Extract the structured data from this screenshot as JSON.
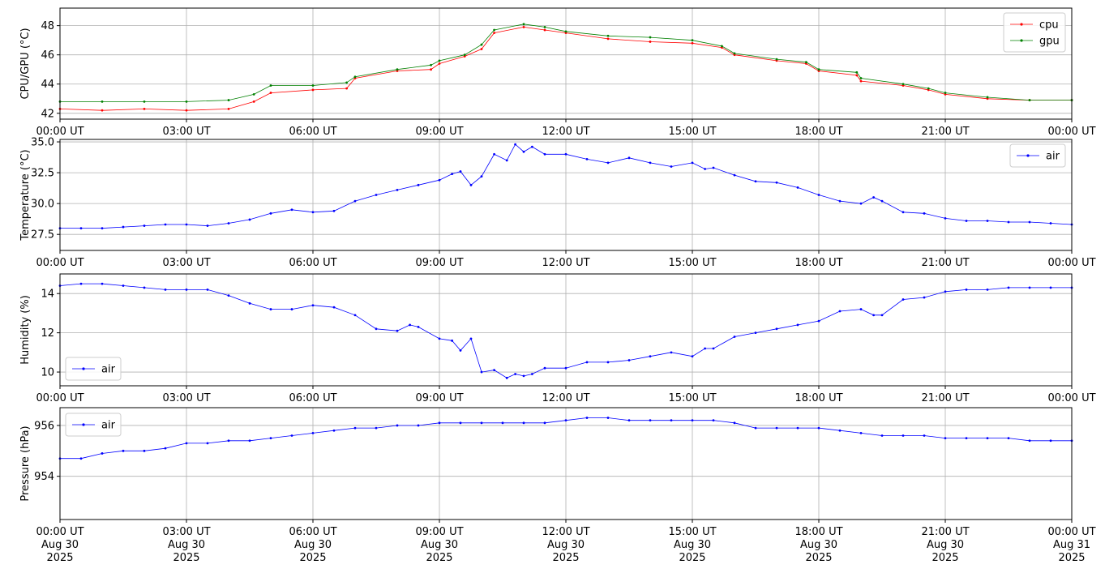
{
  "chart_data": [
    {
      "type": "line",
      "ylabel": "CPU/GPU (°C)",
      "ylim": [
        41.6,
        49.2
      ],
      "yticks": [
        42,
        44,
        46,
        48
      ],
      "ytick_labels": [
        "42",
        "44",
        "46",
        "48"
      ],
      "xticks": [
        0,
        3,
        6,
        9,
        12,
        15,
        18,
        21,
        24
      ],
      "xtick_labels": [
        "00:00 UT",
        "03:00 UT",
        "06:00 UT",
        "09:00 UT",
        "12:00 UT",
        "15:00 UT",
        "18:00 UT",
        "21:00 UT",
        "00:00 UT"
      ],
      "grid": true,
      "legend": "top-right",
      "series": [
        {
          "name": "cpu",
          "color": "#ff0000",
          "x": [
            0,
            1,
            2,
            3,
            4,
            4.6,
            5,
            6,
            6.8,
            7,
            8,
            8.8,
            9,
            9.6,
            10,
            10.3,
            11,
            11.5,
            12,
            13,
            14,
            15,
            15.7,
            16,
            17,
            17.7,
            18,
            18.9,
            19,
            20,
            20.6,
            21,
            22,
            23,
            24
          ],
          "y": [
            42.3,
            42.2,
            42.3,
            42.2,
            42.3,
            42.8,
            43.4,
            43.6,
            43.7,
            44.4,
            44.9,
            45.0,
            45.4,
            45.9,
            46.4,
            47.5,
            47.9,
            47.7,
            47.5,
            47.1,
            46.9,
            46.8,
            46.5,
            46.0,
            45.6,
            45.4,
            44.9,
            44.6,
            44.2,
            43.9,
            43.6,
            43.3,
            43.0,
            42.9,
            42.9
          ]
        },
        {
          "name": "gpu",
          "color": "#008000",
          "x": [
            0,
            1,
            2,
            3,
            4,
            4.6,
            5,
            6,
            6.8,
            7,
            8,
            8.8,
            9,
            9.6,
            10,
            10.3,
            11,
            11.5,
            12,
            13,
            14,
            15,
            15.7,
            16,
            17,
            17.7,
            18,
            18.9,
            19,
            20,
            20.6,
            21,
            22,
            23,
            24
          ],
          "y": [
            42.8,
            42.8,
            42.8,
            42.8,
            42.9,
            43.3,
            43.9,
            43.9,
            44.1,
            44.5,
            45.0,
            45.3,
            45.6,
            46.0,
            46.7,
            47.7,
            48.1,
            47.9,
            47.6,
            47.3,
            47.2,
            47.0,
            46.6,
            46.1,
            45.7,
            45.5,
            45.0,
            44.8,
            44.4,
            44.0,
            43.7,
            43.4,
            43.1,
            42.9,
            42.9
          ]
        }
      ]
    },
    {
      "type": "line",
      "ylabel": "Temperature (°C)",
      "ylim": [
        26.2,
        35.2
      ],
      "yticks": [
        27.5,
        30.0,
        32.5,
        35.0
      ],
      "ytick_labels": [
        "27.5",
        "30.0",
        "32.5",
        "35.0"
      ],
      "xticks": [
        0,
        3,
        6,
        9,
        12,
        15,
        18,
        21,
        24
      ],
      "xtick_labels": [
        "00:00 UT",
        "03:00 UT",
        "06:00 UT",
        "09:00 UT",
        "12:00 UT",
        "15:00 UT",
        "18:00 UT",
        "21:00 UT",
        "00:00 UT"
      ],
      "grid": true,
      "legend": "top-right",
      "series": [
        {
          "name": "air",
          "color": "#0000ff",
          "x": [
            0,
            0.5,
            1,
            1.5,
            2,
            2.5,
            3,
            3.5,
            4,
            4.5,
            5,
            5.5,
            6,
            6.5,
            7,
            7.5,
            8,
            8.5,
            9,
            9.3,
            9.5,
            9.75,
            10,
            10.3,
            10.6,
            10.8,
            11,
            11.2,
            11.5,
            12,
            12.5,
            13,
            13.5,
            14,
            14.5,
            15,
            15.3,
            15.5,
            16,
            16.5,
            17,
            17.5,
            18,
            18.5,
            19,
            19.3,
            19.5,
            20,
            20.5,
            21,
            21.5,
            22,
            22.5,
            23,
            23.5,
            24
          ],
          "y": [
            28.0,
            28.0,
            28.0,
            28.1,
            28.2,
            28.3,
            28.3,
            28.2,
            28.4,
            28.7,
            29.2,
            29.5,
            29.3,
            29.4,
            30.2,
            30.7,
            31.1,
            31.5,
            31.9,
            32.4,
            32.6,
            31.5,
            32.2,
            34.0,
            33.5,
            34.8,
            34.2,
            34.6,
            34.0,
            34.0,
            33.6,
            33.3,
            33.7,
            33.3,
            33.0,
            33.3,
            32.8,
            32.9,
            32.3,
            31.8,
            31.7,
            31.3,
            30.7,
            30.2,
            30.0,
            30.5,
            30.2,
            29.3,
            29.2,
            28.8,
            28.6,
            28.6,
            28.5,
            28.5,
            28.4,
            28.3
          ]
        }
      ]
    },
    {
      "type": "line",
      "ylabel": "Humidity (%)",
      "ylim": [
        9.3,
        15.0
      ],
      "yticks": [
        10,
        12,
        14
      ],
      "ytick_labels": [
        "10",
        "12",
        "14"
      ],
      "xticks": [
        0,
        3,
        6,
        9,
        12,
        15,
        18,
        21,
        24
      ],
      "xtick_labels": [
        "00:00 UT",
        "03:00 UT",
        "06:00 UT",
        "09:00 UT",
        "12:00 UT",
        "15:00 UT",
        "18:00 UT",
        "21:00 UT",
        "00:00 UT"
      ],
      "grid": true,
      "legend": "bottom-left",
      "series": [
        {
          "name": "air",
          "color": "#0000ff",
          "x": [
            0,
            0.5,
            1,
            1.5,
            2,
            2.5,
            3,
            3.5,
            4,
            4.5,
            5,
            5.5,
            6,
            6.5,
            7,
            7.5,
            8,
            8.3,
            8.5,
            9,
            9.3,
            9.5,
            9.75,
            10,
            10.3,
            10.6,
            10.8,
            11,
            11.2,
            11.5,
            12,
            12.5,
            13,
            13.5,
            14,
            14.5,
            15,
            15.3,
            15.5,
            16,
            16.5,
            17,
            17.5,
            18,
            18.5,
            19,
            19.3,
            19.5,
            20,
            20.5,
            21,
            21.5,
            22,
            22.5,
            23,
            23.5,
            24
          ],
          "y": [
            14.4,
            14.5,
            14.5,
            14.4,
            14.3,
            14.2,
            14.2,
            14.2,
            13.9,
            13.5,
            13.2,
            13.2,
            13.4,
            13.3,
            12.9,
            12.2,
            12.1,
            12.4,
            12.3,
            11.7,
            11.6,
            11.1,
            11.7,
            10.0,
            10.1,
            9.7,
            9.9,
            9.8,
            9.9,
            10.2,
            10.2,
            10.5,
            10.5,
            10.6,
            10.8,
            11.0,
            10.8,
            11.2,
            11.2,
            11.8,
            12.0,
            12.2,
            12.4,
            12.6,
            13.1,
            13.2,
            12.9,
            12.9,
            13.7,
            13.8,
            14.1,
            14.2,
            14.2,
            14.3,
            14.3,
            14.3,
            14.3
          ]
        }
      ]
    },
    {
      "type": "line",
      "ylabel": "Pressure (hPa)",
      "ylim": [
        952.3,
        956.7
      ],
      "yticks": [
        954,
        956
      ],
      "ytick_labels": [
        "954",
        "956"
      ],
      "xticks": [
        0,
        3,
        6,
        9,
        12,
        15,
        18,
        21,
        24
      ],
      "xtick_labels": [
        "00:00 UT\nAug 30\n2025",
        "03:00 UT\nAug 30\n2025",
        "06:00 UT\nAug 30\n2025",
        "09:00 UT\nAug 30\n2025",
        "12:00 UT\nAug 30\n2025",
        "15:00 UT\nAug 30\n2025",
        "18:00 UT\nAug 30\n2025",
        "21:00 UT\nAug 30\n2025",
        "00:00 UT\nAug 31\n2025"
      ],
      "grid": true,
      "legend": "top-left",
      "series": [
        {
          "name": "air",
          "color": "#0000ff",
          "x": [
            0,
            0.5,
            1,
            1.5,
            2,
            2.5,
            3,
            3.5,
            4,
            4.5,
            5,
            5.5,
            6,
            6.5,
            7,
            7.5,
            8,
            8.5,
            9,
            9.5,
            10,
            10.5,
            11,
            11.5,
            12,
            12.5,
            13,
            13.5,
            14,
            14.5,
            15,
            15.5,
            16,
            16.5,
            17,
            17.5,
            18,
            18.5,
            19,
            19.5,
            20,
            20.5,
            21,
            21.5,
            22,
            22.5,
            23,
            23.5,
            24
          ],
          "y": [
            954.7,
            954.7,
            954.9,
            955.0,
            955.0,
            955.1,
            955.3,
            955.3,
            955.4,
            955.4,
            955.5,
            955.6,
            955.7,
            955.8,
            955.9,
            955.9,
            956.0,
            956.0,
            956.1,
            956.1,
            956.1,
            956.1,
            956.1,
            956.1,
            956.2,
            956.3,
            956.3,
            956.2,
            956.2,
            956.2,
            956.2,
            956.2,
            956.1,
            955.9,
            955.9,
            955.9,
            955.9,
            955.8,
            955.7,
            955.6,
            955.6,
            955.6,
            955.5,
            955.5,
            955.5,
            955.5,
            955.4,
            955.4,
            955.4
          ]
        }
      ]
    }
  ]
}
